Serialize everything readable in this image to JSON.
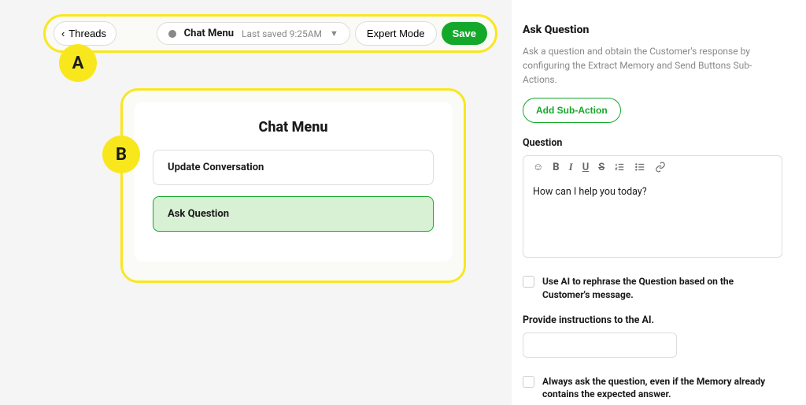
{
  "toolbar": {
    "back_label": "Threads",
    "title": "Chat Menu",
    "saved_label": "Last saved 9:25AM",
    "expert_label": "Expert Mode",
    "save_label": "Save"
  },
  "callouts": {
    "a": "A",
    "b": "B"
  },
  "card": {
    "title": "Chat Menu",
    "actions": [
      {
        "label": "Update Conversation",
        "active": false
      },
      {
        "label": "Ask Question",
        "active": true
      }
    ]
  },
  "panel": {
    "title": "Ask Question",
    "description": "Ask a question and obtain the Customer's response by configuring the Extract Memory and Send Buttons Sub-Actions.",
    "add_sub_action_label": "Add Sub-Action",
    "question_label": "Question",
    "question_value": "How can I help you today?",
    "rephrase_checkbox_label": "Use AI to rephrase the Question based on the Customer's message.",
    "instructions_label": "Provide instructions to the AI.",
    "instructions_value": "",
    "always_ask_checkbox_label": "Always ask the question, even if the Memory already contains the expected answer."
  },
  "colors": {
    "accent_green": "#14a82b",
    "highlight_yellow": "#f9e71e"
  }
}
